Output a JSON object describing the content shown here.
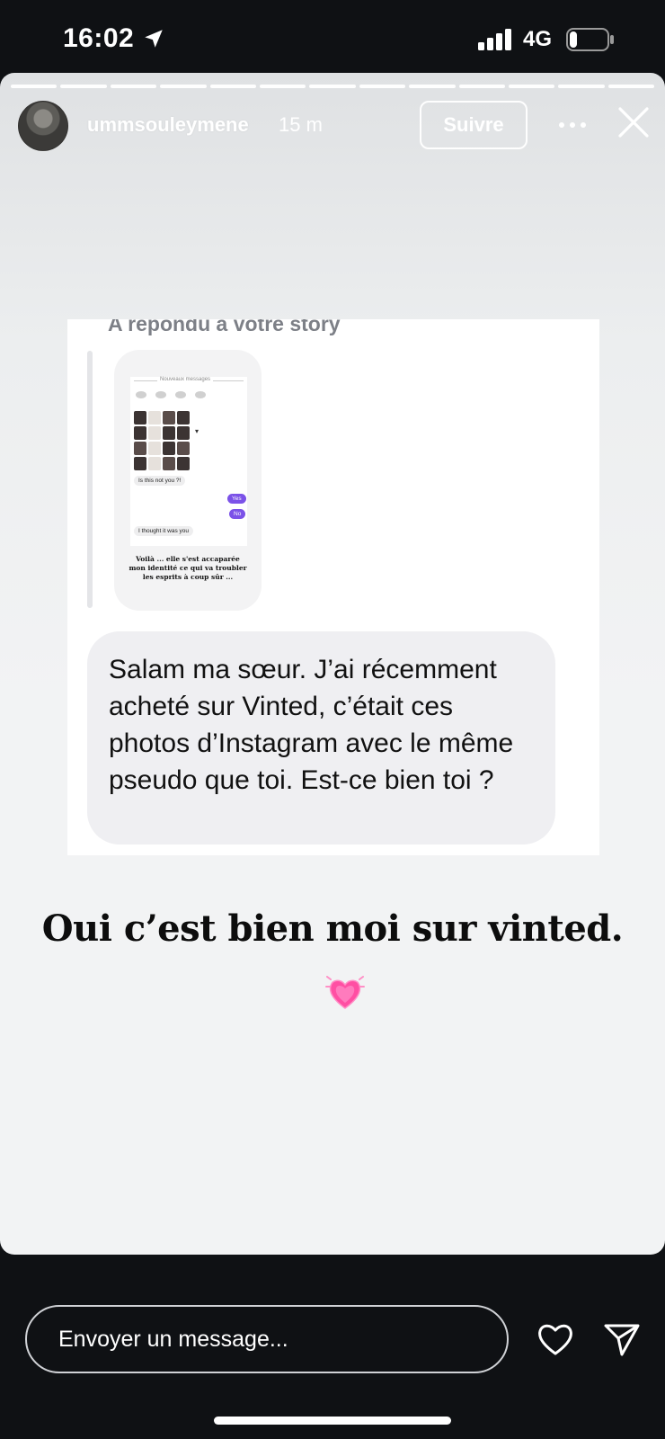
{
  "status_bar": {
    "time": "16:02",
    "network": "4G",
    "battery_level": 0.2
  },
  "story": {
    "progress_segments": 13,
    "username": "ummsouleymene",
    "time_ago": "15 m",
    "follow_label": "Suivre",
    "more_icon": "more-horizontal-icon",
    "close_icon": "close-icon"
  },
  "screenshot": {
    "reply_label": "A répondu à votre story",
    "thumbnail": {
      "header": "Nouveaux messages",
      "bubble_1": "Is this not you ?!",
      "bubble_yes": "Yes",
      "bubble_no": "No",
      "bubble_2": "I thought it was you",
      "caption": "Voilà ... elle s'est accaparée mon identité ce qui va troubler les esprits à coup sûr ..."
    },
    "message": "Salam ma sœur. J’ai récemment acheté sur Vinted, c’était ces photos d’Instagram avec le même pseudo que toi. Est-ce bien toi ?"
  },
  "caption": "Oui c’est bien moi sur vinted.",
  "caption_emoji": "growing-heart-icon",
  "composer": {
    "placeholder": "Envoyer un message...",
    "like_icon": "heart-outline-icon",
    "send_icon": "send-icon"
  },
  "colors": {
    "background": "#0f1114",
    "accent_purple": "#7b52e8",
    "heart_pink": "#ff4fa3"
  }
}
